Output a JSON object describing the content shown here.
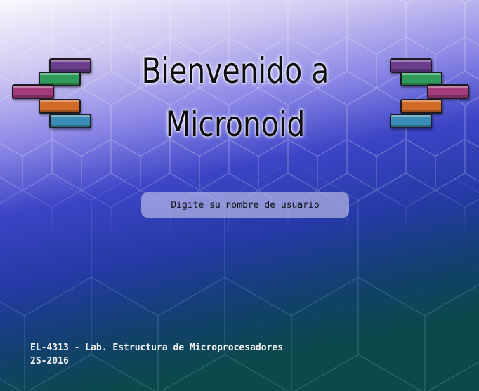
{
  "title_line_1": "Bienvenido a",
  "title_line_2": "Micronoid",
  "prompt_text": "Digite su nombre de usuario",
  "footer_course": "EL-4313 - Lab. Estructura de Microprocesadores",
  "footer_semester": "2S-2016",
  "colors": {
    "brick_purple": "#6a3c8e",
    "brick_green": "#2f9a5a",
    "brick_magenta": "#a43c7c",
    "brick_orange": "#d26a2a",
    "brick_teal": "#3a8cb4",
    "background_top": "#f4f1fb",
    "background_mid": "#3a44c8",
    "background_bottom": "#0a4a52"
  }
}
